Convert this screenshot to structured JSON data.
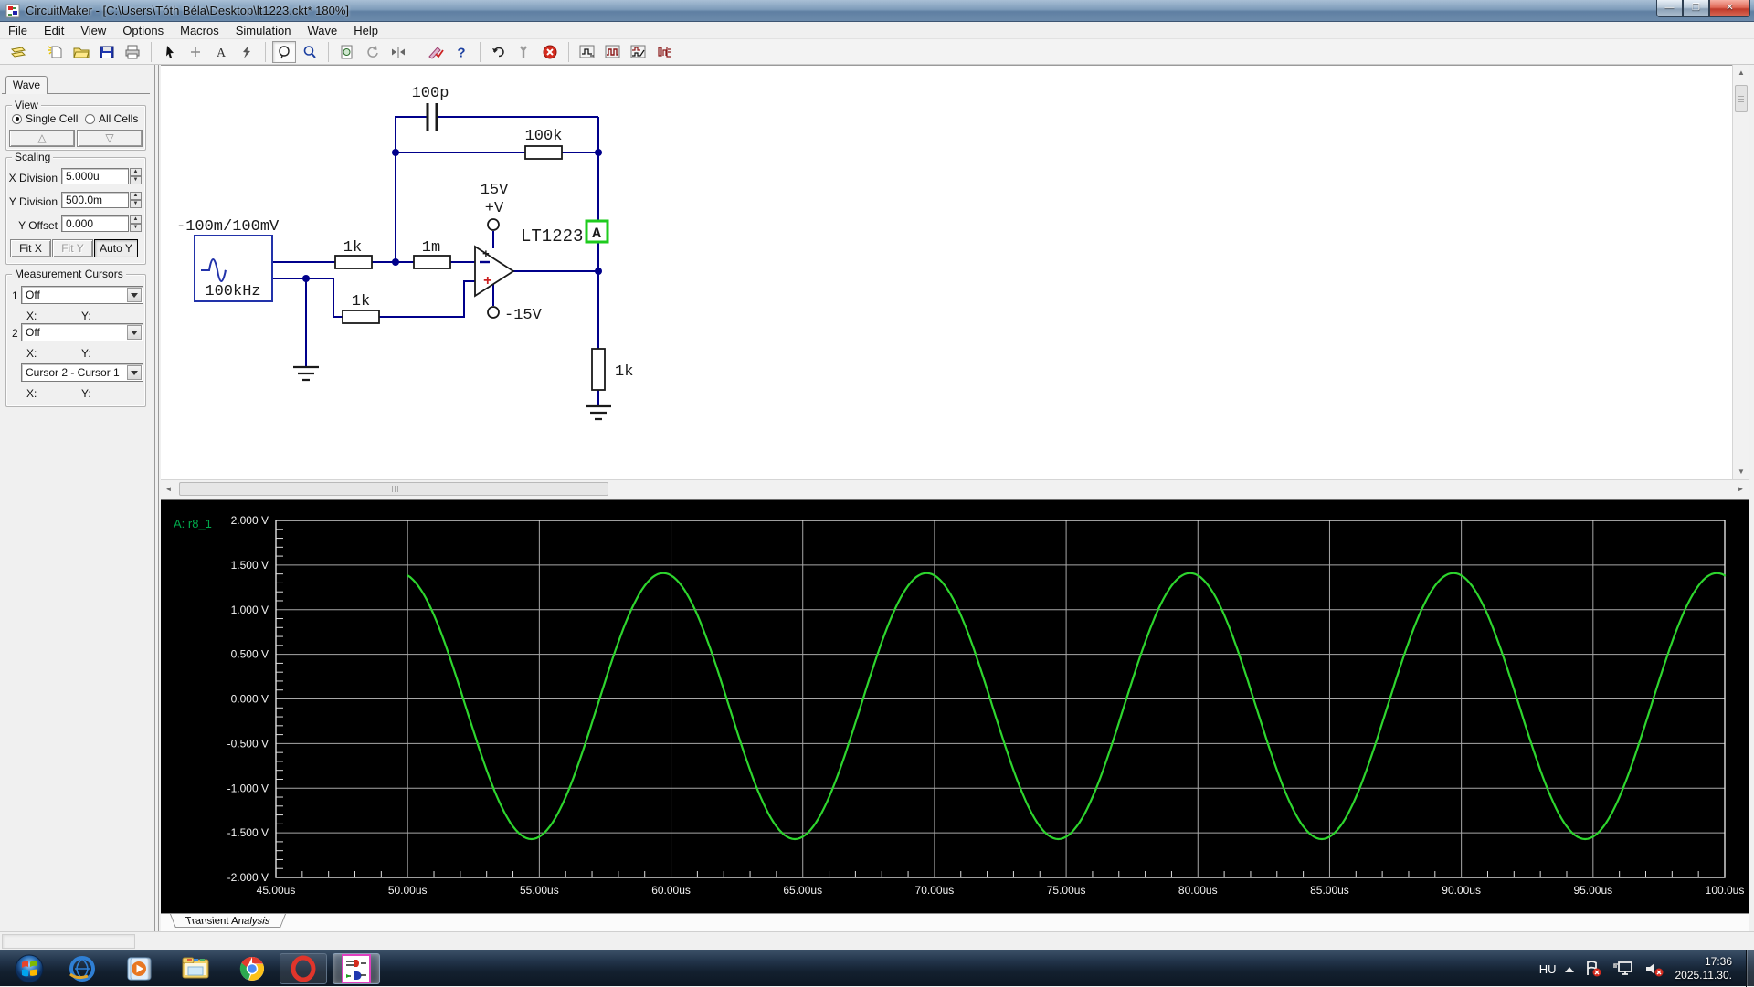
{
  "window": {
    "title": "CircuitMaker - [C:\\Users\\Tóth Béla\\Desktop\\lt1223.ckt* 180%]",
    "buttons": {
      "minimize": "—",
      "restore": "❐",
      "close": "✕"
    }
  },
  "menu": {
    "items": [
      "File",
      "Edit",
      "View",
      "Options",
      "Macros",
      "Simulation",
      "Wave",
      "Help"
    ]
  },
  "toolbar": {
    "icons": [
      "parts-bin",
      "new-file",
      "open-file",
      "save-file",
      "print",
      "select-cursor",
      "wire-plus",
      "text-tool",
      "delete-tool",
      "zoom-select",
      "zoom",
      "preview",
      "rotate",
      "mirror",
      "simulation-edit",
      "help",
      "reset",
      "tools-wrench",
      "stop",
      "analog-scope",
      "digital-scope",
      "mixed-scope",
      "logic-probe"
    ],
    "pressed_icon": "zoom-select"
  },
  "panel": {
    "tab": "Wave",
    "view": {
      "title": "View",
      "single_cell": "Single Cell",
      "all_cells": "All Cells",
      "selected": "Single Cell",
      "up_button": "△",
      "down_button": "▽"
    },
    "scaling": {
      "title": "Scaling",
      "fields": [
        {
          "label": "X Division",
          "value": "5.000u"
        },
        {
          "label": "Y Division",
          "value": "500.0m"
        },
        {
          "label": "Y Offset",
          "value": "0.000"
        }
      ],
      "buttons": [
        {
          "label": "Fit X",
          "state": "normal"
        },
        {
          "label": "Fit Y",
          "state": "disabled"
        },
        {
          "label": "Auto Y",
          "state": "pressed"
        }
      ]
    },
    "cursors": {
      "title": "Measurement Cursors",
      "row1_index": "1",
      "row1_value": "Off",
      "row2_index": "2",
      "row2_value": "Off",
      "delta_value": "Cursor 2 - Cursor 1",
      "x_label": "X:",
      "y_label": "Y:"
    }
  },
  "schematic": {
    "wire_color": "#00008b",
    "source": {
      "range": "-100m/100mV",
      "frequency": "100kHz"
    },
    "labels": {
      "c_fb": "100p",
      "r_fb": "100k",
      "r_in": "1k",
      "r_gain": "1m",
      "v_plus": "15V",
      "v_plus_pin": "+V",
      "v_minus": "-15V",
      "opamp": "LT1223",
      "probe": "A",
      "r_load": "1k",
      "r_gnd": "1k",
      "plus_in": "+",
      "plus_pwr": "+"
    },
    "probe_color": "#1ecb1e"
  },
  "chart_data": {
    "type": "line",
    "title": "Transient Analysis",
    "trace_label": "A: r8_1",
    "trace_label_color": "#00a94b",
    "background": "#000000",
    "grid": true,
    "x_range_us": [
      45,
      100
    ],
    "y_range_v": [
      -2,
      2
    ],
    "x_major_step_us": 5,
    "x_minor_step_us": 1,
    "y_major_step_v": 0.5,
    "y_minor_step_v": 0.1,
    "x_ticks": [
      "45.00us",
      "50.00us",
      "55.00us",
      "60.00us",
      "65.00us",
      "70.00us",
      "75.00us",
      "80.00us",
      "85.00us",
      "90.00us",
      "95.00us",
      "100.0us"
    ],
    "y_ticks": [
      "2.000 V",
      "1.500 V",
      "1.000 V",
      "0.500 V",
      "0.000 V",
      "-0.500 V",
      "-1.000 V",
      "-1.500 V",
      "-2.000 V"
    ],
    "series": [
      {
        "name": "A: r8_1",
        "color": "#2ed52e",
        "waveform": {
          "shape": "sine",
          "t_start_us": 50,
          "t_end_us": 100,
          "period_us": 10,
          "amplitude_v": 1.49,
          "offset_v": -0.08,
          "peak_time_us": 59.7
        }
      }
    ]
  },
  "bottom_tab": {
    "label": "Transient Analysis"
  },
  "taskbar": {
    "items": [
      "start",
      "internet-explorer",
      "media-player",
      "file-explorer",
      "chrome",
      "opera",
      "circuitmaker"
    ],
    "open_item": "opera",
    "active_item": "circuitmaker",
    "tray": {
      "language": "HU",
      "time": "17:36",
      "date": "2025.11.30."
    }
  }
}
